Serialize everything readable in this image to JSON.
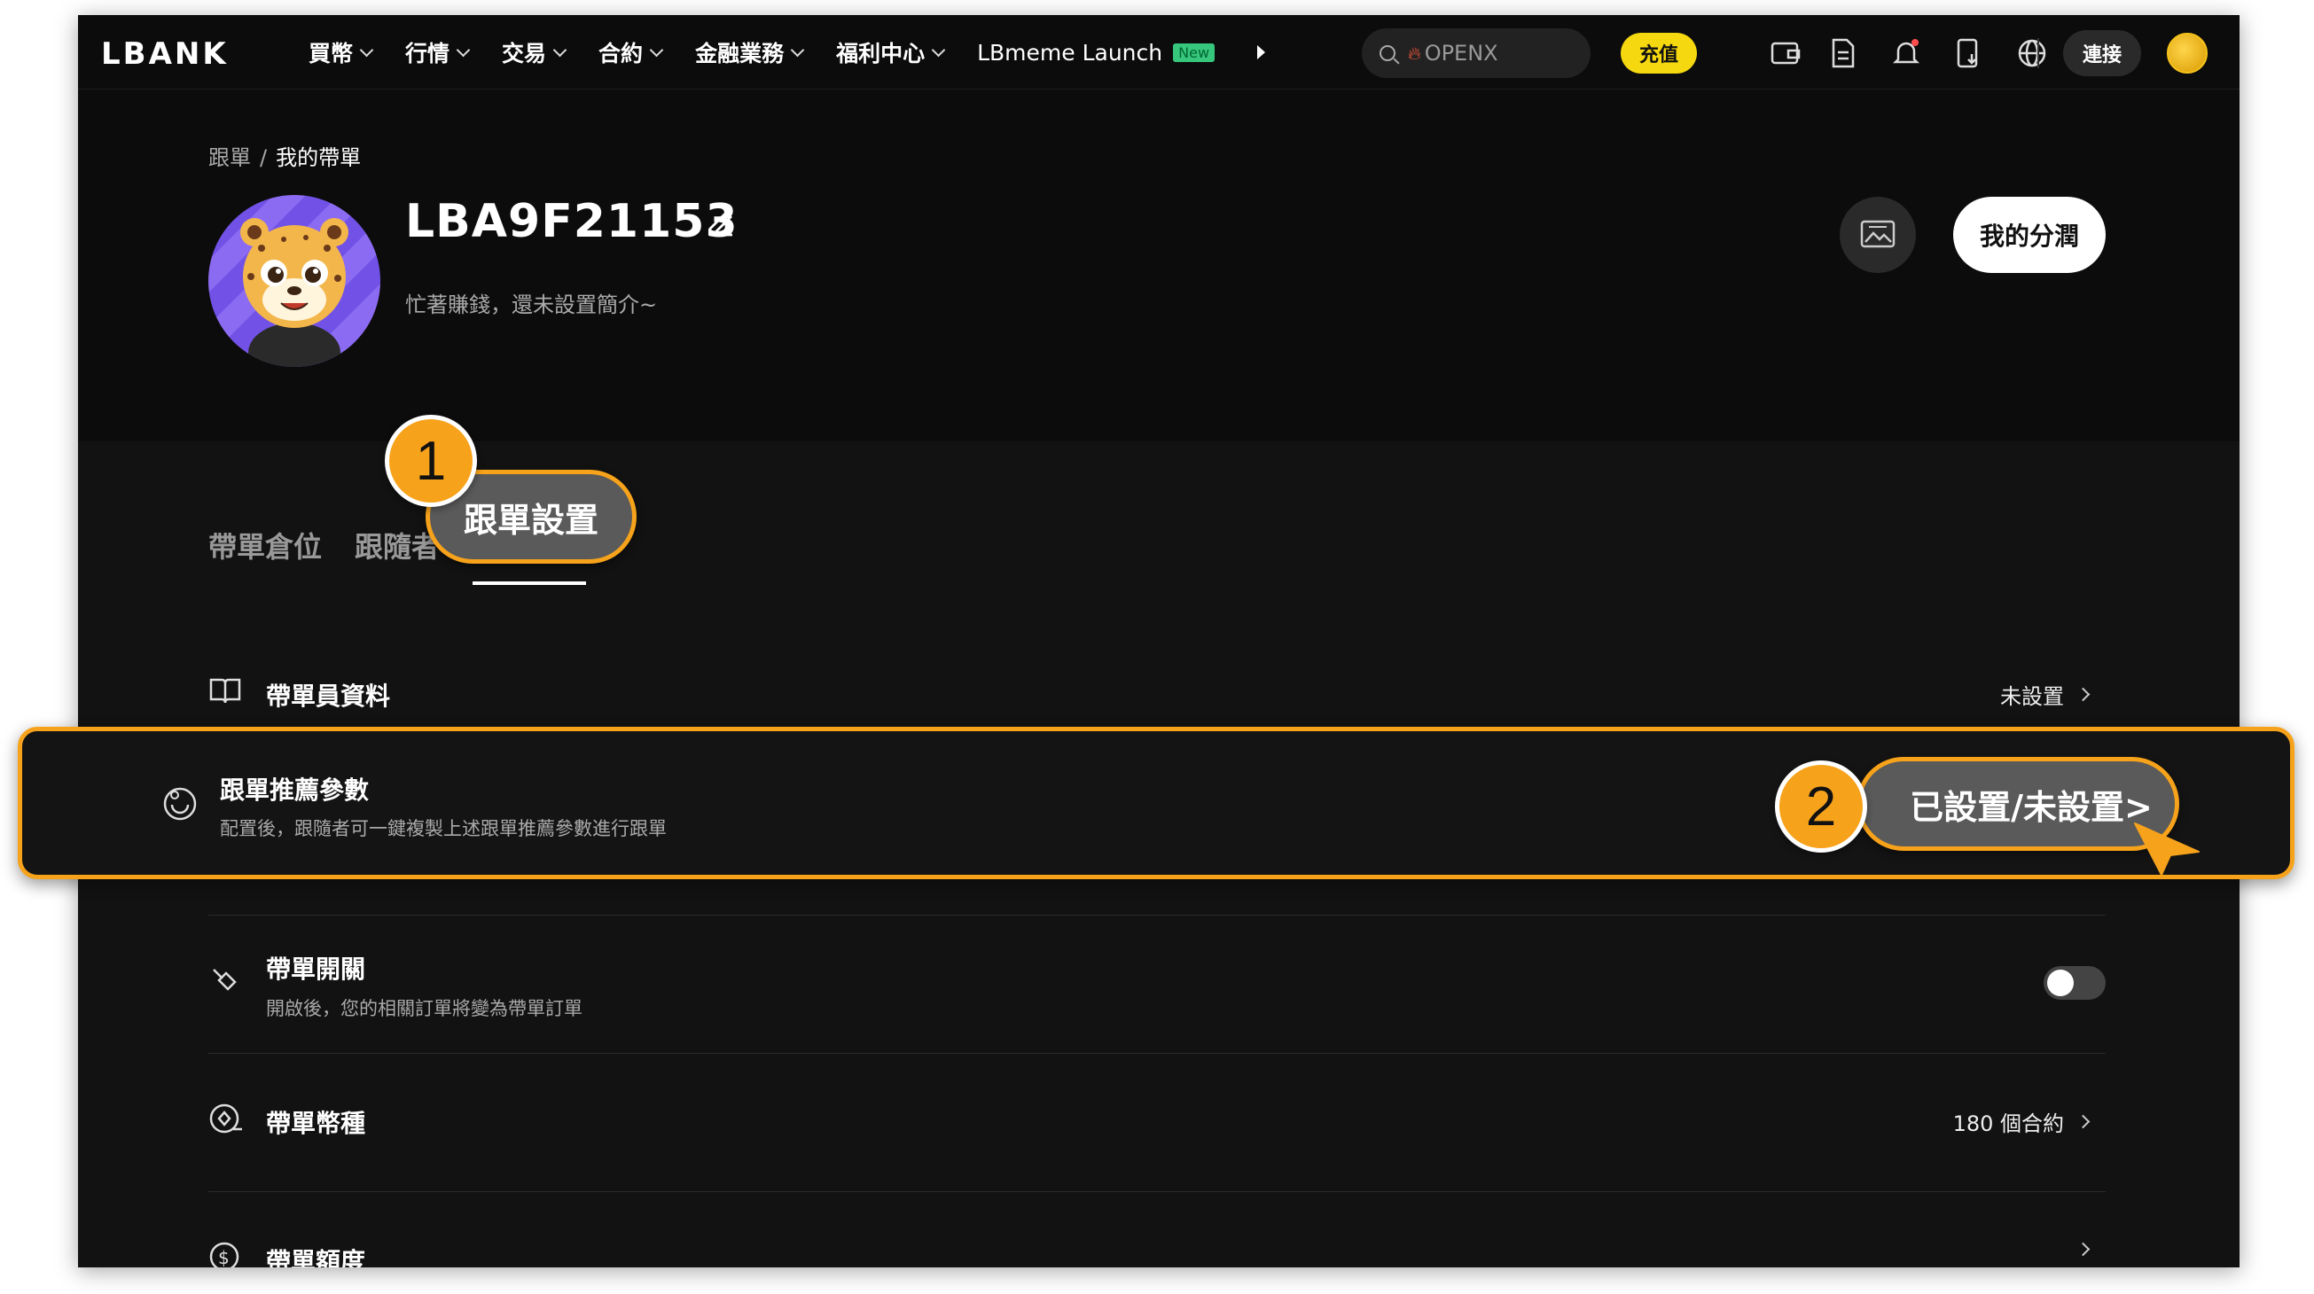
{
  "brand": "LBANK",
  "nav": {
    "items": [
      {
        "label": "買幣"
      },
      {
        "label": "行情"
      },
      {
        "label": "交易"
      },
      {
        "label": "合約"
      },
      {
        "label": "金融業務"
      },
      {
        "label": "福利中心"
      }
    ],
    "launch_label": "LBmeme Launch",
    "launch_badge": "New"
  },
  "search": {
    "placeholder": "OPENX"
  },
  "header_actions": {
    "deposit": "充值",
    "connect": "連接",
    "icons": [
      "wallet-icon",
      "orders-icon",
      "bell-icon",
      "download-icon",
      "globe-icon"
    ]
  },
  "breadcrumb": {
    "parent": "跟單",
    "separator": "/",
    "current": "我的帶單"
  },
  "profile": {
    "username": "LBA9F21153",
    "bio": "忙著賺錢，還未設置簡介~",
    "profit_button": "我的分潤"
  },
  "tabs": [
    {
      "label": "帶單倉位"
    },
    {
      "label": "跟隨者"
    }
  ],
  "settings": {
    "trader_info": {
      "title": "帶單員資料",
      "value": "未設置"
    },
    "recommend_params": {
      "title": "跟單推薦參數",
      "desc": "配置後，跟隨者可一鍵複製上述跟單推薦參數進行跟單"
    },
    "copy_switch": {
      "title": "帶單開關",
      "desc": "開啟後，您的相關訂單將變為帶單訂單",
      "enabled": false
    },
    "coins": {
      "title": "帶單幣種",
      "value": "180 個合約"
    },
    "quota": {
      "title": "帶單額度"
    }
  },
  "annotations": {
    "step1_number": "1",
    "step1_label": "跟單設置",
    "step2_number": "2",
    "step2_label": "已設置/未設置>"
  },
  "colors": {
    "accent": "#f7a21b",
    "deposit": "#f5d80f",
    "background": "#0c0c0c"
  }
}
